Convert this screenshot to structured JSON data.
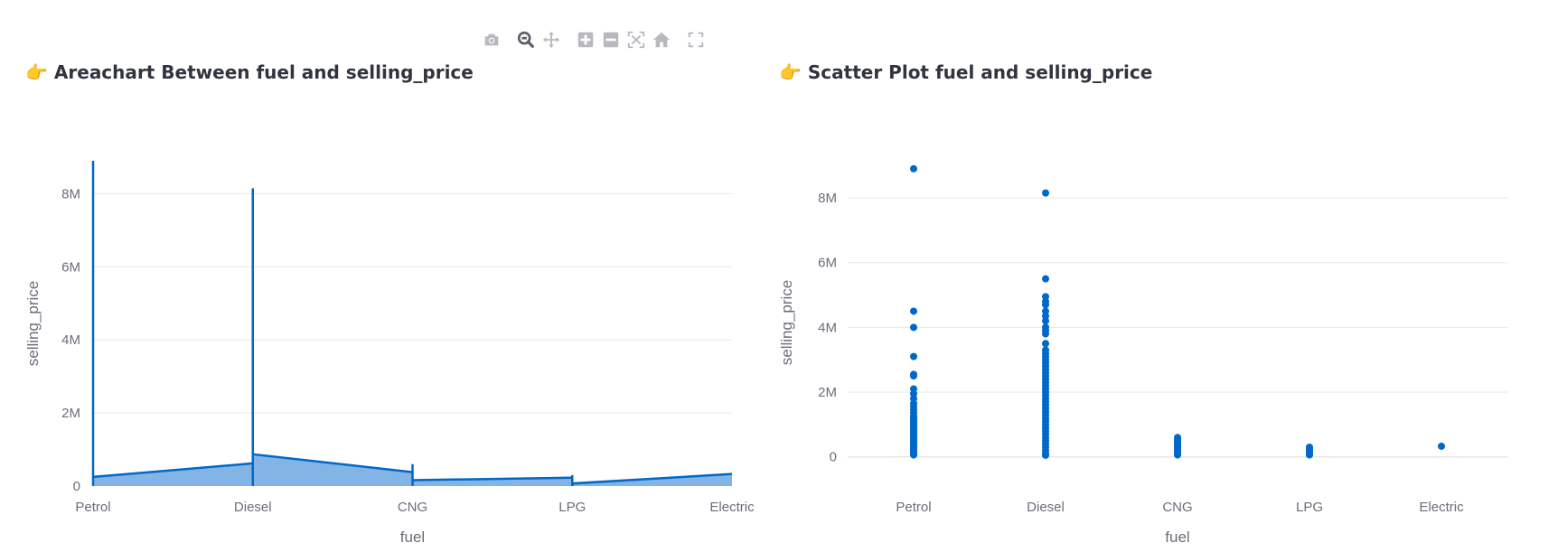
{
  "toolbar": {
    "icons": [
      "camera-icon",
      "zoom-icon",
      "pan-icon",
      "zoom-in-icon",
      "zoom-out-icon",
      "autoscale-icon",
      "home-icon",
      "fullscreen-icon"
    ],
    "icon_color": "#b8b9bf",
    "active_icon_color": "#5f6068"
  },
  "left": {
    "title_emoji": "👉",
    "title": "Areachart Between fuel and selling_price"
  },
  "right": {
    "title_emoji": "👉",
    "title": "Scatter Plot fuel and selling_price"
  },
  "colors": {
    "line": "#0068c9",
    "fill": "#83b4e6",
    "grid": "#e6e7ea",
    "text": "#6b6d7a"
  },
  "chart_data": [
    {
      "type": "area",
      "title": "Areachart Between fuel and selling_price",
      "xlabel": "fuel",
      "ylabel": "selling_price",
      "categories": [
        "Petrol",
        "Diesel",
        "CNG",
        "LPG",
        "Electric"
      ],
      "ylim": [
        0,
        8900000
      ],
      "yticks": [
        0,
        2000000,
        4000000,
        6000000,
        8000000
      ],
      "ytick_labels": [
        "0",
        "2M",
        "4M",
        "6M",
        "8M"
      ],
      "grid": true,
      "segments": [
        {
          "from_x": 0,
          "from_y": 250000,
          "to_x": 1,
          "to_y": 620000,
          "spike_max": 8900000
        },
        {
          "from_x": 1,
          "from_y": 870000,
          "to_x": 2,
          "to_y": 380000,
          "spike_max": 8150000
        },
        {
          "from_x": 2,
          "from_y": 160000,
          "to_x": 3,
          "to_y": 230000,
          "spike_max": 600000
        },
        {
          "from_x": 3,
          "from_y": 70000,
          "to_x": 4,
          "to_y": 330000,
          "spike_max": 300000
        }
      ]
    },
    {
      "type": "scatter",
      "title": "Scatter Plot fuel and selling_price",
      "xlabel": "fuel",
      "ylabel": "selling_price",
      "categories": [
        "Petrol",
        "Diesel",
        "CNG",
        "LPG",
        "Electric"
      ],
      "ylim": [
        -900000,
        9200000
      ],
      "yticks": [
        0,
        2000000,
        4000000,
        6000000,
        8000000
      ],
      "ytick_labels": [
        "0",
        "2M",
        "4M",
        "6M",
        "8M"
      ],
      "grid": true,
      "series": [
        {
          "category": "Petrol",
          "values": [
            8900000,
            4500000,
            4000000,
            3100000,
            2550000,
            2500000,
            2100000,
            1950000,
            1800000,
            1650000,
            1550000,
            1450000,
            1350000,
            1250000,
            1200000,
            1150000,
            1100000,
            1050000,
            1000000,
            950000,
            900000,
            850000,
            800000,
            750000,
            700000,
            650000,
            600000,
            550000,
            500000,
            450000,
            400000,
            350000,
            300000,
            250000,
            200000,
            150000,
            100000,
            60000
          ]
        },
        {
          "category": "Diesel",
          "values": [
            8150000,
            5500000,
            4950000,
            4800000,
            4700000,
            4500000,
            4350000,
            4200000,
            4000000,
            3900000,
            3800000,
            3500000,
            3300000,
            3200000,
            3100000,
            3000000,
            2900000,
            2800000,
            2700000,
            2600000,
            2500000,
            2400000,
            2300000,
            2200000,
            2100000,
            2000000,
            1900000,
            1800000,
            1700000,
            1600000,
            1500000,
            1400000,
            1300000,
            1200000,
            1100000,
            1000000,
            900000,
            800000,
            700000,
            600000,
            500000,
            400000,
            300000,
            200000,
            100000,
            50000
          ]
        },
        {
          "category": "CNG",
          "values": [
            600000,
            550000,
            500000,
            450000,
            400000,
            350000,
            300000,
            250000,
            200000,
            150000,
            100000,
            60000
          ]
        },
        {
          "category": "LPG",
          "values": [
            300000,
            250000,
            200000,
            150000,
            100000,
            60000
          ]
        },
        {
          "category": "Electric",
          "values": [
            330000
          ]
        }
      ]
    }
  ]
}
